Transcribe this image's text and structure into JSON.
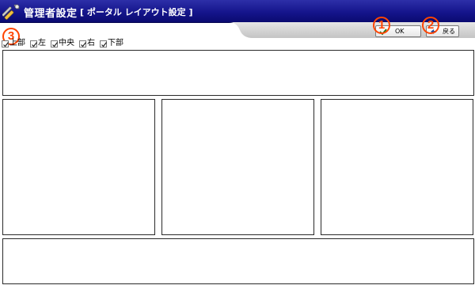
{
  "header": {
    "app_title": "管理者設定",
    "section_title": "[ ポータル レイアウト設定 ]",
    "icon": "tools-icon"
  },
  "toolbar": {
    "ok_label": "OK",
    "ok_icon": "ok-check-icon",
    "back_label": "戻る",
    "back_icon": "back-arrow-icon"
  },
  "callouts": [
    "1",
    "2",
    "3"
  ],
  "layout_options": [
    {
      "label": "上部",
      "checked": true
    },
    {
      "label": "左",
      "checked": true
    },
    {
      "label": "中央",
      "checked": true
    },
    {
      "label": "右",
      "checked": true
    },
    {
      "label": "下部",
      "checked": true
    }
  ],
  "colors": {
    "header_bg": "#15158c",
    "callout": "#ff4400",
    "toolbar_strip": "#d0d0d0"
  }
}
